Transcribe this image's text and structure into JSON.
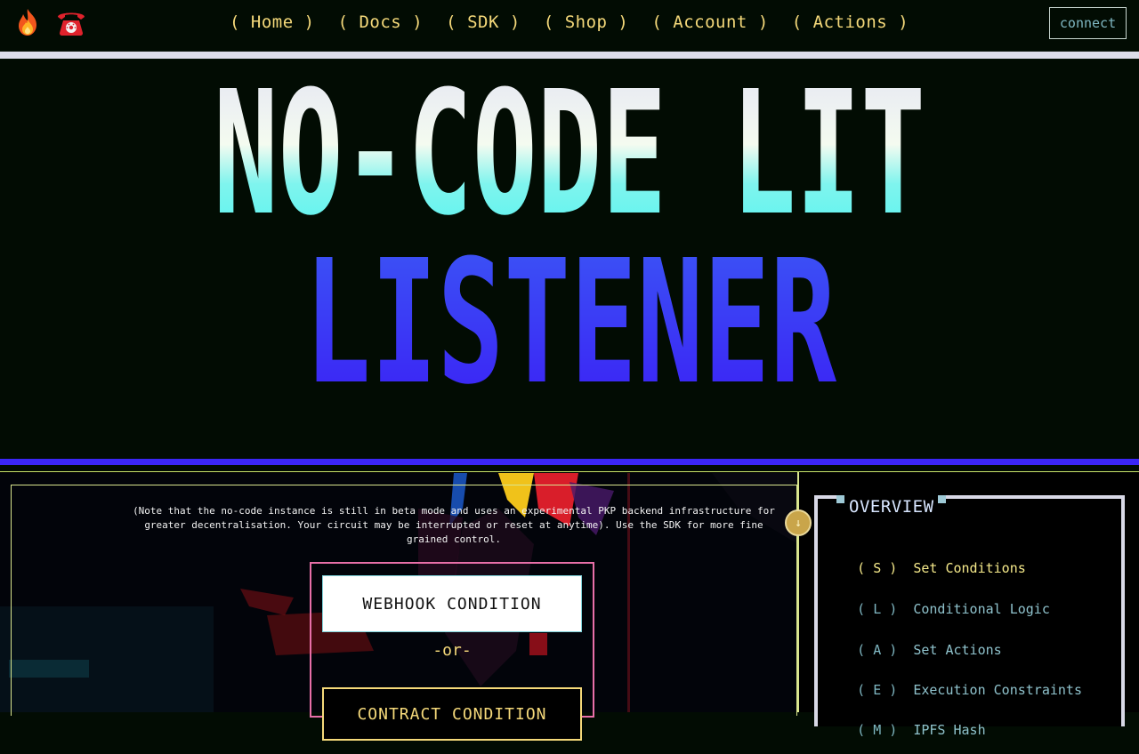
{
  "nav": {
    "icons": [
      "fire-icon",
      "telephone-icon"
    ],
    "links": [
      {
        "id": "home",
        "label": "Home"
      },
      {
        "id": "docs",
        "label": "Docs"
      },
      {
        "id": "sdk",
        "label": "SDK"
      },
      {
        "id": "shop",
        "label": "Shop"
      },
      {
        "id": "account",
        "label": "Account"
      },
      {
        "id": "actions",
        "label": "Actions"
      }
    ],
    "connect_label": "connect"
  },
  "hero": {
    "line1": "NO-CODE LIT",
    "line2": "LISTENER"
  },
  "main": {
    "note": "(Note that the no-code instance is still in beta mode and uses an experimental PKP backend infrastructure for greater decentralisation. Your circuit may be interrupted or reset at anytime). Use the SDK for more fine grained control.",
    "webhook_label": "WEBHOOK CONDITION",
    "or_label": "-or-",
    "contract_label": "CONTRACT CONDITION"
  },
  "overview": {
    "title": "OVERVIEW",
    "items": [
      {
        "key": "S",
        "label": "Set Conditions",
        "active": true
      },
      {
        "key": "L",
        "label": "Conditional Logic",
        "active": false
      },
      {
        "key": "A",
        "label": "Set Actions",
        "active": false
      },
      {
        "key": "E",
        "label": "Execution Constraints",
        "active": false
      },
      {
        "key": "M",
        "label": "IPFS Hash",
        "active": false
      }
    ]
  },
  "colors": {
    "accent_yellow": "#f5d97a",
    "hero_blue": "#3b26f5",
    "hero_cyan": "#4ff5f0",
    "border_lime": "#d9e58e",
    "border_pink": "#e86fa8"
  }
}
